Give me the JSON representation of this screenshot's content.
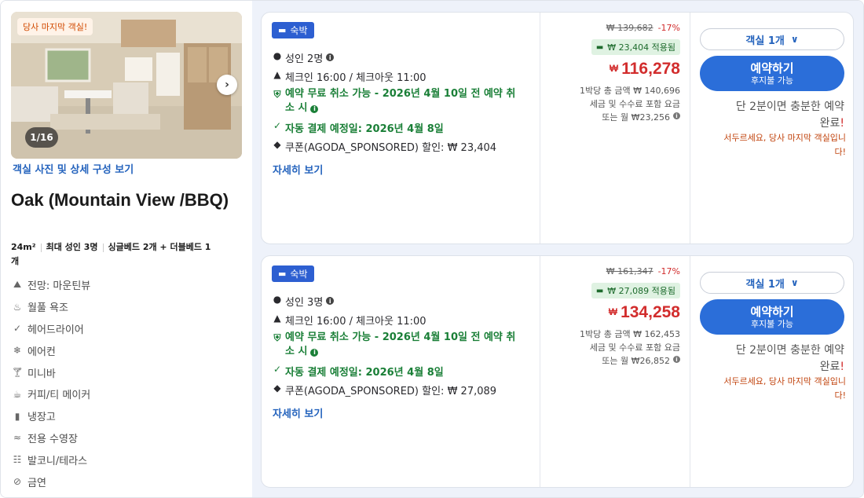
{
  "left": {
    "photo": {
      "tag": "당사 마지막 객실!",
      "counter": "1/16",
      "link": "객실 사진 및 상세 구성 보기"
    },
    "room_name": "Oak (Mountain View /BBQ)",
    "meta": {
      "size": "24m²",
      "occupancy": "최대 성인 3명",
      "beds_line1": "싱글베드 2개 + 더블베드 1",
      "beds_line2": "개"
    },
    "amenities": [
      {
        "icon": "view-icon",
        "label": "전망: 마운틴뷰"
      },
      {
        "icon": "bathtub-icon",
        "label": "월풀 욕조"
      },
      {
        "icon": "check-icon",
        "label": "헤어드라이어"
      },
      {
        "icon": "fan-icon",
        "label": "에어컨"
      },
      {
        "icon": "cocktail-icon",
        "label": "미니바"
      },
      {
        "icon": "coffee-icon",
        "label": "커피/티 메이커"
      },
      {
        "icon": "fridge-icon",
        "label": "냉장고"
      },
      {
        "icon": "pool-icon",
        "label": "전용 수영장"
      },
      {
        "icon": "balcony-icon",
        "label": "발코니/테라스"
      },
      {
        "icon": "no-smoking-icon",
        "label": "금연"
      }
    ]
  },
  "offers": [
    {
      "badge": "숙박",
      "guests": "성인 2명",
      "checkin": "체크인 16:00 / 체크아웃 11:00",
      "cancel_line1": "예약 무료 취소 가능 - 2026년 4월 10일 전 예약 취",
      "cancel_line2": "소 시",
      "autopay": "자동 결제 예정일: 2026년 4월 8일",
      "coupon": "쿠폰(AGODA_SPONSORED) 할인: ₩ 23,404",
      "details": "자세히 보기",
      "old_price": "₩ 139,682",
      "discount": "-17%",
      "applied": "₩ 23,404 적용됨",
      "currency": "₩",
      "price": "116,278",
      "total_line": "1박당 총 금액 ₩ 140,696",
      "tax_line": "세금 및 수수료 포함 요금",
      "monthly_line": "또는 월 ₩23,256",
      "rooms_select": "객실 1개",
      "book_main": "예약하기",
      "book_sub": "후지불 가능",
      "hurry_line1": "단 2분이면 충분한 예약",
      "hurry_line2": "완료",
      "hurry_exc": "!",
      "urgent_line1": "서두르세요, 당사 마지막 객실입니",
      "urgent_line2": "다!"
    },
    {
      "badge": "숙박",
      "guests": "성인 3명",
      "checkin": "체크인 16:00 / 체크아웃 11:00",
      "cancel_line1": "예약 무료 취소 가능 - 2026년 4월 10일 전 예약 취",
      "cancel_line2": "소 시",
      "autopay": "자동 결제 예정일: 2026년 4월 8일",
      "coupon": "쿠폰(AGODA_SPONSORED) 할인: ₩ 27,089",
      "details": "자세히 보기",
      "old_price": "₩ 161,347",
      "discount": "-17%",
      "applied": "₩ 27,089 적용됨",
      "currency": "₩",
      "price": "134,258",
      "total_line": "1박당 총 금액 ₩ 162,453",
      "tax_line": "세금 및 수수료 포함 요금",
      "monthly_line": "또는 월 ₩26,852",
      "rooms_select": "객실 1개",
      "book_main": "예약하기",
      "book_sub": "후지불 가능",
      "hurry_line1": "단 2분이면 충분한 예약",
      "hurry_line2": "완료",
      "hurry_exc": "!",
      "urgent_line1": "서두르세요, 당사 마지막 객실입니",
      "urgent_line2": "다!"
    }
  ],
  "colors": {
    "accent": "#2b6ed9",
    "price": "#d22d2d",
    "green": "#1a7f37",
    "badge": "#2d5fd1"
  }
}
